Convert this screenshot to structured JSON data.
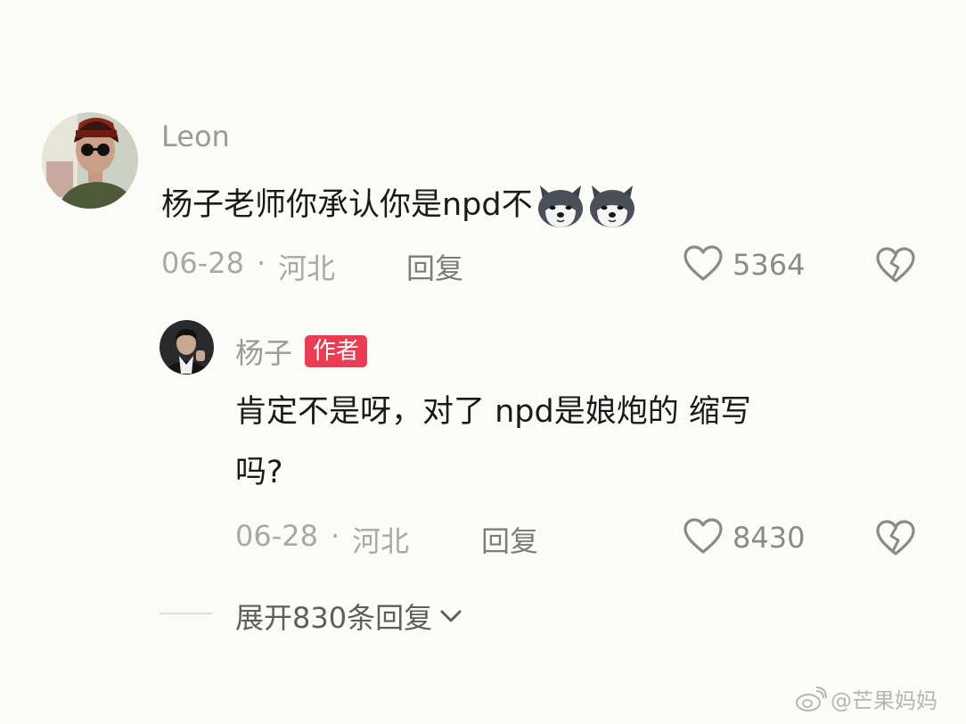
{
  "comment": {
    "username": "Leon",
    "text": "杨子老师你承认你是npd不",
    "emojis": [
      "husky-dog-emoji",
      "husky-dog-emoji"
    ],
    "date": "06-28",
    "separator": "·",
    "location": "河北",
    "reply_label": "回复",
    "like_count": "5364"
  },
  "reply": {
    "username": "杨子",
    "badge": "作者",
    "text_line1": "肯定不是呀，对了 npd是娘炮的 缩写",
    "text_line2": "吗?",
    "date": "06-28",
    "separator": "·",
    "location": "河北",
    "reply_label": "回复",
    "like_count": "8430"
  },
  "expand": {
    "label": "展开830条回复"
  },
  "watermark": {
    "text": "@芒果妈妈"
  },
  "colors": {
    "background": "#fbfbf8",
    "author_badge": "#ea3c53",
    "muted_text": "#a8a8a8"
  }
}
